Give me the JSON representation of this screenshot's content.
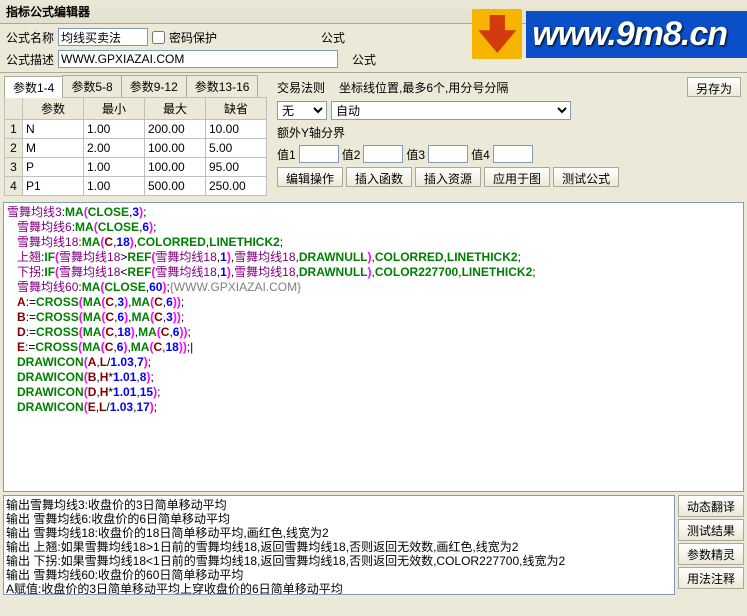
{
  "title": "指标公式编辑器",
  "watermark": "www.9m8.cn",
  "form": {
    "name_lbl": "公式名称",
    "name_val": "均线买卖法",
    "pw_lbl": "密码保护",
    "type_lbl": "公式",
    "desc_lbl": "公式描述",
    "desc_val": "WWW.GPXIAZAI.COM"
  },
  "tabs": [
    "参数1-4",
    "参数5-8",
    "参数9-12",
    "参数13-16"
  ],
  "param_headers": [
    "参数",
    "最小",
    "最大",
    "缺省"
  ],
  "params": [
    {
      "i": "1",
      "n": "N",
      "min": "1.00",
      "max": "200.00",
      "def": "10.00"
    },
    {
      "i": "2",
      "n": "M",
      "min": "2.00",
      "max": "100.00",
      "def": "5.00"
    },
    {
      "i": "3",
      "n": "P",
      "min": "1.00",
      "max": "100.00",
      "def": "95.00"
    },
    {
      "i": "4",
      "n": "P1",
      "min": "1.00",
      "max": "500.00",
      "def": "250.00"
    }
  ],
  "right": {
    "rule_lbl": "交易法则",
    "coord_lbl": "坐标线位置,最多6个,用分号分隔",
    "saveas": "另存为",
    "sel_no": "无",
    "sel_auto": "自动",
    "axis_lbl": "额外Y轴分界",
    "v1": "值1",
    "v2": "值2",
    "v3": "值3",
    "v4": "值4"
  },
  "btns": {
    "edit": "编辑操作",
    "insfn": "插入函数",
    "insres": "插入资源",
    "apply": "应用于图",
    "test": "测试公式"
  },
  "code": [
    [
      [
        "nav",
        "雪舞均线3"
      ],
      [
        "p",
        ":"
      ],
      [
        "kw",
        "MA"
      ],
      [
        "br",
        "("
      ],
      [
        "fn",
        "CLOSE"
      ],
      [
        "p",
        ","
      ],
      [
        "n",
        "3"
      ],
      [
        "br",
        ")"
      ],
      [
        "p",
        ";"
      ]
    ],
    [
      [
        "p",
        "   "
      ],
      [
        "nav",
        "雪舞均线6"
      ],
      [
        "p",
        ":"
      ],
      [
        "kw",
        "MA"
      ],
      [
        "br",
        "("
      ],
      [
        "fn",
        "CLOSE"
      ],
      [
        "p",
        ","
      ],
      [
        "n",
        "6"
      ],
      [
        "br",
        ")"
      ],
      [
        "p",
        ";"
      ]
    ],
    [
      [
        "p",
        "   "
      ],
      [
        "nav",
        "雪舞均线18"
      ],
      [
        "p",
        ":"
      ],
      [
        "kw",
        "MA"
      ],
      [
        "br",
        "("
      ],
      [
        "id",
        "C"
      ],
      [
        "p",
        ","
      ],
      [
        "n",
        "18"
      ],
      [
        "br",
        ")"
      ],
      [
        "p",
        ","
      ],
      [
        "fn",
        "COLORRED"
      ],
      [
        "p",
        ","
      ],
      [
        "fn",
        "LINETHICK2"
      ],
      [
        "p",
        ";"
      ]
    ],
    [
      [
        "p",
        "   "
      ],
      [
        "nav",
        "上翘"
      ],
      [
        "p",
        ":"
      ],
      [
        "kw",
        "IF"
      ],
      [
        "br",
        "("
      ],
      [
        "nav",
        "雪舞均线18"
      ],
      [
        "p",
        ">"
      ],
      [
        "kw",
        "REF"
      ],
      [
        "br",
        "("
      ],
      [
        "nav",
        "雪舞均线18"
      ],
      [
        "p",
        ","
      ],
      [
        "n",
        "1"
      ],
      [
        "br",
        ")"
      ],
      [
        "p",
        ","
      ],
      [
        "nav",
        "雪舞均线18"
      ],
      [
        "p",
        ","
      ],
      [
        "fn",
        "DRAWNULL"
      ],
      [
        "br",
        ")"
      ],
      [
        "p",
        ","
      ],
      [
        "fn",
        "COLORRED"
      ],
      [
        "p",
        ","
      ],
      [
        "fn",
        "LINETHICK2"
      ],
      [
        "p",
        ";"
      ]
    ],
    [
      [
        "p",
        "   "
      ],
      [
        "nav",
        "下拐"
      ],
      [
        "p",
        ":"
      ],
      [
        "kw",
        "IF"
      ],
      [
        "br",
        "("
      ],
      [
        "nav",
        "雪舞均线18"
      ],
      [
        "p",
        "<"
      ],
      [
        "kw",
        "REF"
      ],
      [
        "br",
        "("
      ],
      [
        "nav",
        "雪舞均线18"
      ],
      [
        "p",
        ","
      ],
      [
        "n",
        "1"
      ],
      [
        "br",
        ")"
      ],
      [
        "p",
        ","
      ],
      [
        "nav",
        "雪舞均线18"
      ],
      [
        "p",
        ","
      ],
      [
        "fn",
        "DRAWNULL"
      ],
      [
        "br",
        ")"
      ],
      [
        "p",
        ","
      ],
      [
        "fn",
        "COLOR227700"
      ],
      [
        "p",
        ","
      ],
      [
        "fn",
        "LINETHICK2"
      ],
      [
        "p",
        ";"
      ]
    ],
    [
      [
        "p",
        "   "
      ],
      [
        "nav",
        "雪舞均线60"
      ],
      [
        "p",
        ":"
      ],
      [
        "kw",
        "MA"
      ],
      [
        "br",
        "("
      ],
      [
        "fn",
        "CLOSE"
      ],
      [
        "p",
        ","
      ],
      [
        "n",
        "60"
      ],
      [
        "br",
        ")"
      ],
      [
        "p",
        ";"
      ],
      [
        "cmt",
        "{WWW.GPXIAZAI.COM}"
      ]
    ],
    [
      [
        "p",
        "   "
      ],
      [
        "id",
        "A"
      ],
      [
        "p",
        ":="
      ],
      [
        "kw",
        "CROSS"
      ],
      [
        "br",
        "("
      ],
      [
        "kw",
        "MA"
      ],
      [
        "br",
        "("
      ],
      [
        "id",
        "C"
      ],
      [
        "p",
        ","
      ],
      [
        "n",
        "3"
      ],
      [
        "br",
        ")"
      ],
      [
        "p",
        ","
      ],
      [
        "kw",
        "MA"
      ],
      [
        "br",
        "("
      ],
      [
        "id",
        "C"
      ],
      [
        "p",
        ","
      ],
      [
        "n",
        "6"
      ],
      [
        "br",
        ")"
      ],
      [
        "br",
        ")"
      ],
      [
        "p",
        ";"
      ]
    ],
    [
      [
        "p",
        "   "
      ],
      [
        "id",
        "B"
      ],
      [
        "p",
        ":="
      ],
      [
        "kw",
        "CROSS"
      ],
      [
        "br",
        "("
      ],
      [
        "kw",
        "MA"
      ],
      [
        "br",
        "("
      ],
      [
        "id",
        "C"
      ],
      [
        "p",
        ","
      ],
      [
        "n",
        "6"
      ],
      [
        "br",
        ")"
      ],
      [
        "p",
        ","
      ],
      [
        "kw",
        "MA"
      ],
      [
        "br",
        "("
      ],
      [
        "id",
        "C"
      ],
      [
        "p",
        ","
      ],
      [
        "n",
        "3"
      ],
      [
        "br",
        ")"
      ],
      [
        "br",
        ")"
      ],
      [
        "p",
        ";"
      ]
    ],
    [
      [
        "p",
        "   "
      ],
      [
        "id",
        "D"
      ],
      [
        "p",
        ":="
      ],
      [
        "kw",
        "CROSS"
      ],
      [
        "br",
        "("
      ],
      [
        "kw",
        "MA"
      ],
      [
        "br",
        "("
      ],
      [
        "id",
        "C"
      ],
      [
        "p",
        ","
      ],
      [
        "n",
        "18"
      ],
      [
        "br",
        ")"
      ],
      [
        "p",
        ","
      ],
      [
        "kw",
        "MA"
      ],
      [
        "br",
        "("
      ],
      [
        "id",
        "C"
      ],
      [
        "p",
        ","
      ],
      [
        "n",
        "6"
      ],
      [
        "br",
        ")"
      ],
      [
        "br",
        ")"
      ],
      [
        "p",
        ";"
      ]
    ],
    [
      [
        "p",
        "   "
      ],
      [
        "id",
        "E"
      ],
      [
        "p",
        ":="
      ],
      [
        "kw",
        "CROSS"
      ],
      [
        "br",
        "("
      ],
      [
        "kw",
        "MA"
      ],
      [
        "br",
        "("
      ],
      [
        "id",
        "C"
      ],
      [
        "p",
        ","
      ],
      [
        "n",
        "6"
      ],
      [
        "br",
        ")"
      ],
      [
        "p",
        ","
      ],
      [
        "kw",
        "MA"
      ],
      [
        "br",
        "("
      ],
      [
        "id",
        "C"
      ],
      [
        "p",
        ","
      ],
      [
        "n",
        "18"
      ],
      [
        "br",
        ")"
      ],
      [
        "br",
        ")"
      ],
      [
        "p",
        ";|"
      ]
    ],
    [
      [
        "p",
        "   "
      ],
      [
        "kw",
        "DRAWICON"
      ],
      [
        "br",
        "("
      ],
      [
        "id",
        "A"
      ],
      [
        "p",
        ","
      ],
      [
        "id",
        "L"
      ],
      [
        "p",
        "/"
      ],
      [
        "n",
        "1.03"
      ],
      [
        "p",
        ","
      ],
      [
        "n",
        "7"
      ],
      [
        "br",
        ")"
      ],
      [
        "p",
        ";"
      ]
    ],
    [
      [
        "p",
        "   "
      ],
      [
        "kw",
        "DRAWICON"
      ],
      [
        "br",
        "("
      ],
      [
        "id",
        "B"
      ],
      [
        "p",
        ","
      ],
      [
        "id",
        "H"
      ],
      [
        "p",
        "*"
      ],
      [
        "n",
        "1.01"
      ],
      [
        "p",
        ","
      ],
      [
        "n",
        "8"
      ],
      [
        "br",
        ")"
      ],
      [
        "p",
        ";"
      ]
    ],
    [
      [
        "p",
        "   "
      ],
      [
        "kw",
        "DRAWICON"
      ],
      [
        "br",
        "("
      ],
      [
        "id",
        "D"
      ],
      [
        "p",
        ","
      ],
      [
        "id",
        "H"
      ],
      [
        "p",
        "*"
      ],
      [
        "n",
        "1.01"
      ],
      [
        "p",
        ","
      ],
      [
        "n",
        "15"
      ],
      [
        "br",
        ")"
      ],
      [
        "p",
        ";"
      ]
    ],
    [
      [
        "p",
        "   "
      ],
      [
        "kw",
        "DRAWICON"
      ],
      [
        "br",
        "("
      ],
      [
        "id",
        "E"
      ],
      [
        "p",
        ","
      ],
      [
        "id",
        "L"
      ],
      [
        "p",
        "/"
      ],
      [
        "n",
        "1.03"
      ],
      [
        "p",
        ","
      ],
      [
        "n",
        "17"
      ],
      [
        "br",
        ")"
      ],
      [
        "p",
        ";"
      ]
    ]
  ],
  "output": [
    "输出雪舞均线3:收盘价的3日简单移动平均",
    "输出    雪舞均线6:收盘价的6日简单移动平均",
    "输出    雪舞均线18:收盘价的18日简单移动平均,画红色,线宽为2",
    "输出    上翘:如果雪舞均线18>1日前的雪舞均线18,返回雪舞均线18,否则返回无效数,画红色,线宽为2",
    "输出    下拐:如果雪舞均线18<1日前的雪舞均线18,返回雪舞均线18,否则返回无效数,COLOR227700,线宽为2",
    "输出    雪舞均线60:收盘价的60日简单移动平均",
    "A赋值:收盘价的3日简单移动平均上穿收盘价的6日简单移动平均"
  ],
  "sidebtns": [
    "动态翻译",
    "测试结果",
    "参数精灵",
    "用法注释"
  ]
}
